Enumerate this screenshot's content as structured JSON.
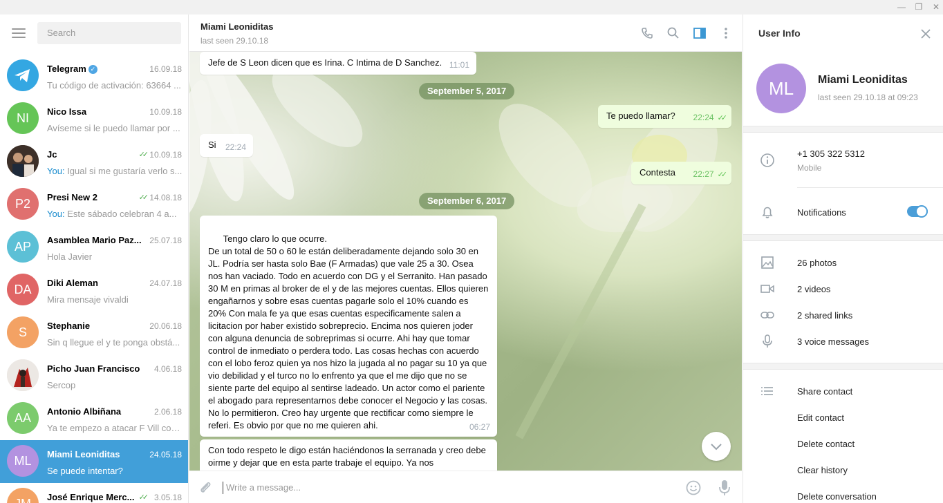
{
  "window": {
    "minimize": "—",
    "restore": "❐",
    "close": "✕"
  },
  "sidebar": {
    "search_placeholder": "Search",
    "dialogs": [
      {
        "name": "Telegram",
        "verified": true,
        "date": "16.09.18",
        "you": "",
        "preview": "Tu código de activación: 63664 ...",
        "avatar_text": "",
        "avatar_color": "#34a7e2",
        "read": false
      },
      {
        "name": "Nico Issa",
        "date": "10.09.18",
        "you": "",
        "preview": "Avíseme si le puedo llamar por ...",
        "avatar_text": "NI",
        "avatar_color": "#65c557",
        "read": false
      },
      {
        "name": "Jc",
        "date": "10.09.18",
        "you": "You:",
        "preview": "Igual si me gustaría verlo s...",
        "avatar_text": "",
        "avatar_color": "#5a4a3e",
        "read": true
      },
      {
        "name": "Presi New 2",
        "date": "14.08.18",
        "you": "You:",
        "preview": "Este sábado celebran 4 a...",
        "avatar_text": "P2",
        "avatar_color": "#e0706f",
        "read": true
      },
      {
        "name": "Asamblea Mario Paz...",
        "date": "25.07.18",
        "you": "",
        "preview": "Hola Javier",
        "avatar_text": "AP",
        "avatar_color": "#5cc0d6",
        "read": false
      },
      {
        "name": "Diki Aleman",
        "date": "24.07.18",
        "you": "",
        "preview": "Mira mensaje vivaldi",
        "avatar_text": "DA",
        "avatar_color": "#e06565",
        "read": false
      },
      {
        "name": "Stephanie",
        "date": "20.06.18",
        "you": "",
        "preview": "Sin q llegue el y te ponga obstá...",
        "avatar_text": "S",
        "avatar_color": "#f3a264",
        "read": false
      },
      {
        "name": "Picho Juan Francisco",
        "date": "4.06.18",
        "you": "",
        "preview": "Sercop",
        "avatar_text": "",
        "avatar_color": "#e9e4e0",
        "read": false
      },
      {
        "name": "Antonio Albiñana",
        "date": "2.06.18",
        "you": "",
        "preview": "Ya te empezo a atacar F Vill con...",
        "avatar_text": "AA",
        "avatar_color": "#7ccb6d",
        "read": false
      },
      {
        "name": "Miami Leoniditas",
        "date": "24.05.18",
        "you": "",
        "preview": "Se puede intentar?",
        "avatar_text": "ML",
        "avatar_color": "#b392e0",
        "read": false,
        "active": true
      },
      {
        "name": "José Enrique Merc...",
        "date": "3.05.18",
        "you": "",
        "preview": "",
        "avatar_text": "JM",
        "avatar_color": "#f3a264",
        "read": true
      }
    ]
  },
  "chat": {
    "title": "Miami Leoniditas",
    "status": "last seen 29.10.18",
    "messages": [
      {
        "text": "Jefe de  S Leon dicen que es Irina. C Intima de D Sanchez.",
        "time": "11:01",
        "out": false
      },
      {
        "date": "September 5, 2017"
      },
      {
        "text": "Te puedo llamar?",
        "time": "22:24",
        "out": true
      },
      {
        "text": "Si",
        "time": "22:24",
        "out": false
      },
      {
        "text": "Contesta",
        "time": "22:27",
        "out": true
      },
      {
        "date": "September 6, 2017"
      },
      {
        "text": "Tengo claro lo que ocurre.\nDe un total de 50 o 60 le están deliberadamente dejando solo 30 en JL. Podría ser hasta solo Bae (F Armadas) que vale 25 a 30. Osea nos han vaciado. Todo en acuerdo con DG y el Serranito. Han pasado 30 M en primas al broker de el y de las mejores cuentas. Ellos quieren engañarnos y sobre esas cuentas pagarle solo el 10% cuando es 20% Con mala fe ya que esas cuentas especificamente salen a licitacion por haber existido sobreprecio. Encima nos quieren joder con alguna denuncia de sobreprimas si ocurre. Ahi hay que tomar control de inmediato o perdera todo. Las cosas hechas con acuerdo con el lobo feroz quien ya nos hizo la jugada al no pagar su 10 ya que vio debilidad y el turco no lo enfrento ya que el me dijo que no se siente parte del equipo al sentirse ladeado. Un actor como el pariente el abogado para representarnos debe conocer el Negocio y las cosas. No lo permitieron. Creo hay urgente que rectificar como siempre le referi. Es obvio por que no me quieren ahi.",
        "time": "06:27",
        "out": false
      },
      {
        "text": "Con todo respeto le digo están haciéndonos la serranada y creo debe oirme y dejar que en esta parte trabaje el equipo. Ya nos",
        "time": "",
        "out": false
      }
    ],
    "composer_placeholder": "Write a message..."
  },
  "user_info": {
    "title": "User Info",
    "avatar_text": "ML",
    "name": "Miami Leoniditas",
    "last_seen": "last seen 29.10.18 at 09:23",
    "phone": "+1 305 322 5312",
    "phone_label": "Mobile",
    "notifications_label": "Notifications",
    "notifications_on": true,
    "media": [
      {
        "icon": "photo-icon",
        "label": "26 photos"
      },
      {
        "icon": "video-icon",
        "label": "2 videos"
      },
      {
        "icon": "link-icon",
        "label": "2 shared links"
      },
      {
        "icon": "mic-icon",
        "label": "3 voice messages"
      }
    ],
    "actions": [
      "Share contact",
      "Edit contact",
      "Delete contact",
      "Clear history",
      "Delete conversation"
    ]
  }
}
